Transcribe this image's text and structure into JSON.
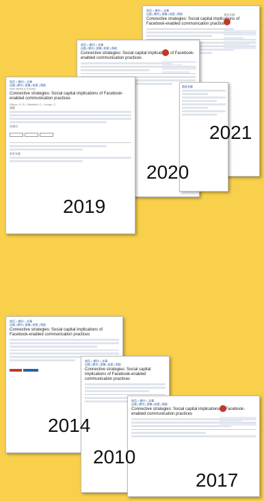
{
  "years": {
    "y2021": "2021",
    "y2020": "2020",
    "y2019": "2019",
    "y2014": "2014",
    "y2010": "2010",
    "y2017": "2017"
  },
  "page": {
    "breadcrumb": "首页 > 期刊 > 文章",
    "nav": "出版 | 期刊 | 投稿 | 检索 | 帮助",
    "article_title": "Connective strategies: Social capital implications of Facebook-enabled communication practices",
    "authors": "Ellison, N. B.; Steinfield, C.; Lampe, C.",
    "journal": "New Media & Society",
    "abstract_label": "摘要",
    "keywords_label": "关键词",
    "refs_label": "参考文献",
    "sidebar_label": "相关文献"
  }
}
